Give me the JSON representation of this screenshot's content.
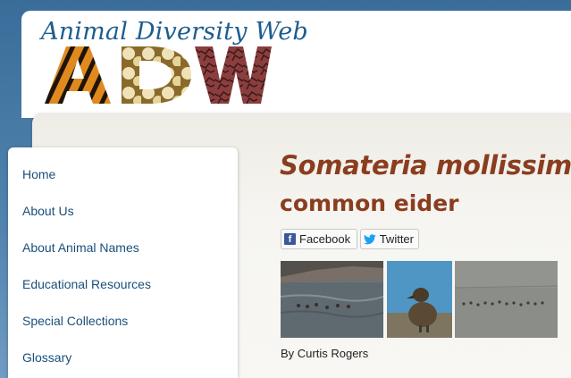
{
  "site": {
    "title": "Animal Diversity Web",
    "logo_text": "ADW"
  },
  "nav": {
    "items": [
      {
        "label": "Home"
      },
      {
        "label": "About Us"
      },
      {
        "label": "About Animal Names"
      },
      {
        "label": "Educational Resources"
      },
      {
        "label": "Special Collections"
      },
      {
        "label": "Glossary"
      }
    ]
  },
  "species": {
    "scientific_name": "Somateria mollissima",
    "common_name": "common eider"
  },
  "share": {
    "facebook_label": "Facebook",
    "twitter_label": "Twitter"
  },
  "photos": {
    "credit": "By Curtis Rogers"
  },
  "colors": {
    "title_blue": "#1d5d8e",
    "species_brown": "#8a3d1f",
    "nav_link": "#1a4f7a",
    "facebook_blue": "#3b5998",
    "twitter_blue": "#1da1f2"
  }
}
